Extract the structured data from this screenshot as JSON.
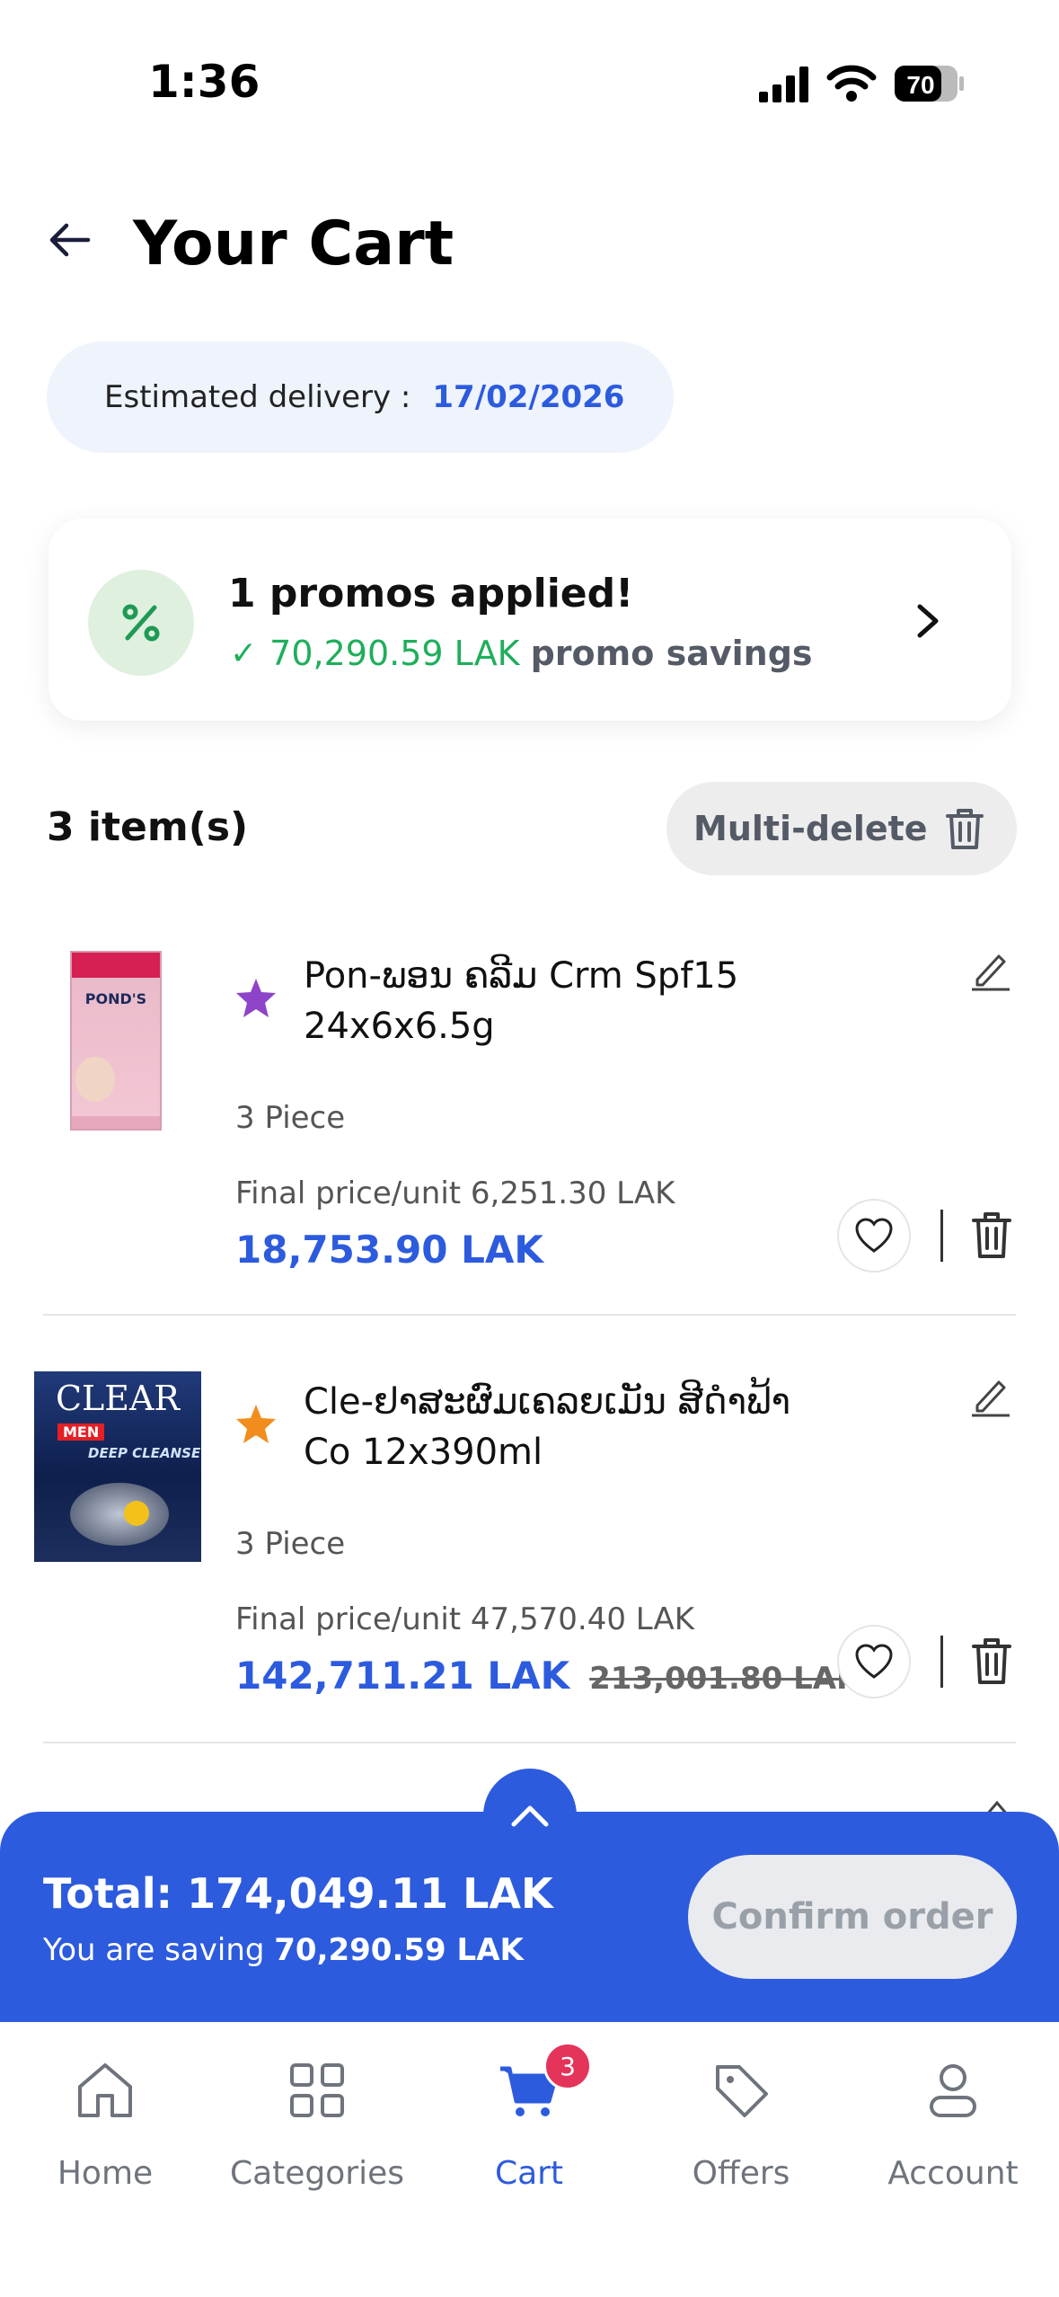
{
  "status_bar": {
    "time": "1:36",
    "battery": "70"
  },
  "header": {
    "title": "Your Cart"
  },
  "delivery": {
    "label": "Estimated delivery :",
    "date": "17/02/2026"
  },
  "promo": {
    "title": "1 promos applied!",
    "amount": "70,290.59 LAK",
    "suffix": "promo savings"
  },
  "items_header": {
    "count": "3 item(s)",
    "multi_delete_label": "Multi-delete"
  },
  "items": [
    {
      "name": "Pon-ພອນ ຄລີມ Crm Spf15 24x6x6.5g",
      "quantity": "3 Piece",
      "unit_price": "Final price/unit 6,251.30 LAK",
      "total": "18,753.90 LAK",
      "old_total": "",
      "star_color": "#8e44c8",
      "thumb_logo": "POND'S"
    },
    {
      "name": "Cle-ຢາສະຜົມເຄລຍເມັນ ສີດຳຟ້າ Co 12x390ml",
      "quantity": "3 Piece",
      "unit_price": "Final price/unit 47,570.40 LAK",
      "total": "142,711.21 LAK",
      "old_total": "213,001.80 LAK",
      "star_color": "#f28c1c",
      "thumb_logo": "CLEAR",
      "thumb_sub": "MEN",
      "thumb_line": "DEEP CLEANSE"
    }
  ],
  "totals": {
    "total_label": "Total: 174,049.11 LAK",
    "saving_label": "You are saving",
    "saving_amount": "70,290.59 LAK",
    "confirm_label": "Confirm order"
  },
  "tabs": [
    {
      "label": "Home",
      "icon": "home-icon"
    },
    {
      "label": "Categories",
      "icon": "grid-icon"
    },
    {
      "label": "Cart",
      "icon": "cart-icon",
      "badge": "3",
      "active": true
    },
    {
      "label": "Offers",
      "icon": "tag-icon"
    },
    {
      "label": "Account",
      "icon": "user-icon"
    }
  ],
  "colors": {
    "accent": "#2d5bde",
    "promo_green": "#1fae5b",
    "badge": "#e4345a"
  }
}
